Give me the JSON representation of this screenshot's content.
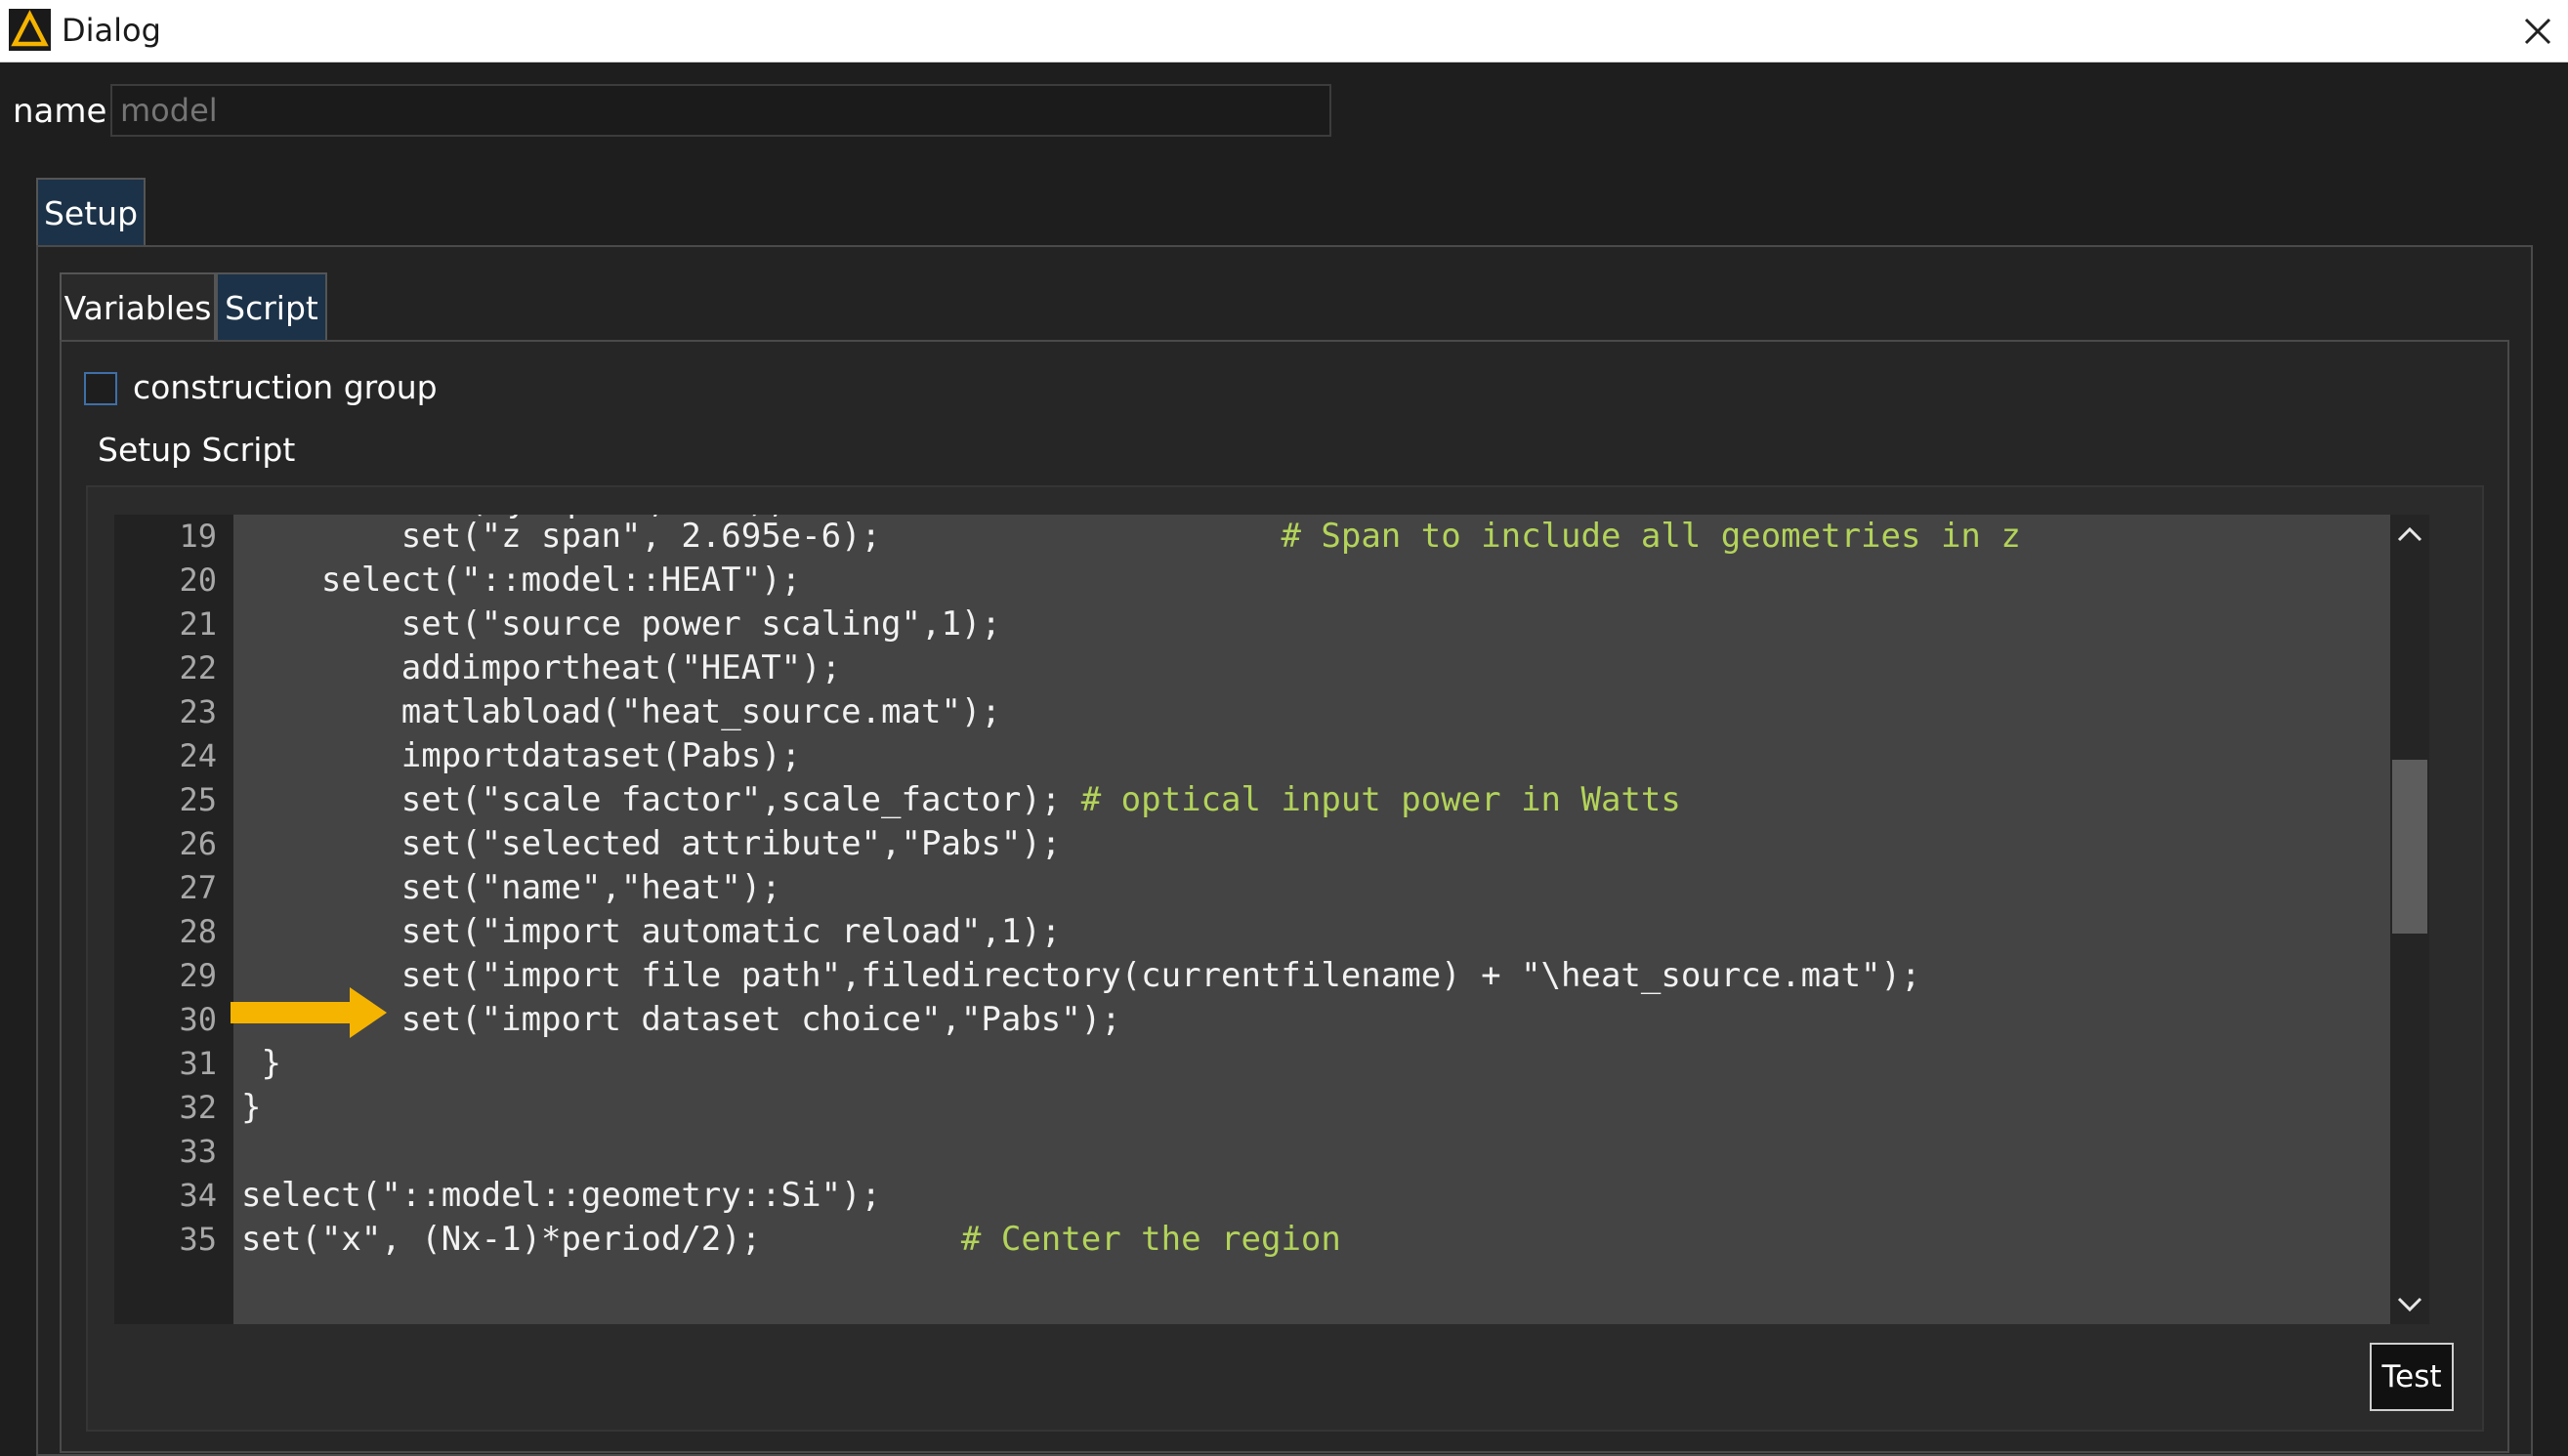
{
  "window": {
    "title": "Dialog"
  },
  "name_field": {
    "label": "name",
    "placeholder": "model"
  },
  "outer_tabs": [
    {
      "label": "Setup",
      "active": true
    }
  ],
  "inner_tabs": [
    {
      "label": "Variables",
      "active": false
    },
    {
      "label": "Script",
      "active": true
    }
  ],
  "construction_group": {
    "label": "construction group",
    "checked": false
  },
  "setup_script": {
    "label": "Setup Script"
  },
  "editor": {
    "first_line_number": 19,
    "highlighted_line": 29,
    "line_numbers": [
      "19",
      "20",
      "21",
      "22",
      "23",
      "24",
      "25",
      "26",
      "27",
      "28",
      "29",
      "30",
      "31",
      "32",
      "33",
      "34",
      "35"
    ],
    "lines": [
      {
        "code": "        set(\"z span\", 2.695e-6);",
        "pad": "                    ",
        "comment": "# Span to include all geometries in z"
      },
      {
        "code": "    select(\"::model::HEAT\");",
        "pad": "",
        "comment": ""
      },
      {
        "code": "        set(\"source power scaling\",1);",
        "pad": "",
        "comment": ""
      },
      {
        "code": "        addimportheat(\"HEAT\");",
        "pad": "",
        "comment": ""
      },
      {
        "code": "        matlabload(\"heat_source.mat\");",
        "pad": "",
        "comment": ""
      },
      {
        "code": "        importdataset(Pabs);",
        "pad": "",
        "comment": ""
      },
      {
        "code": "        set(\"scale factor\",scale_factor);",
        "pad": " ",
        "comment": "# optical input power in Watts"
      },
      {
        "code": "        set(\"selected attribute\",\"Pabs\");",
        "pad": "",
        "comment": ""
      },
      {
        "code": "        set(\"name\",\"heat\");",
        "pad": "",
        "comment": ""
      },
      {
        "code": "        set(\"import automatic reload\",1);",
        "pad": "",
        "comment": ""
      },
      {
        "code": "        set(\"import file path\",filedirectory(currentfilename) + \"\\heat_source.mat\");",
        "pad": "",
        "comment": ""
      },
      {
        "code": "        set(\"import dataset choice\",\"Pabs\");",
        "pad": "",
        "comment": ""
      },
      {
        "code": " }",
        "pad": "",
        "comment": ""
      },
      {
        "code": "}",
        "pad": "",
        "comment": ""
      },
      {
        "code": "",
        "pad": "",
        "comment": ""
      },
      {
        "code": "select(\"::model::geometry::Si\");",
        "pad": "",
        "comment": ""
      },
      {
        "code": "set(\"x\", (Nx-1)*period/2);",
        "pad": "          ",
        "comment": "# Center the region"
      }
    ]
  },
  "test_button": {
    "label": "Test"
  },
  "colors": {
    "arrow": "#f5b400",
    "comment": "#b3d35a",
    "active_tab": "#1c3248",
    "code_bg": "#444444"
  }
}
